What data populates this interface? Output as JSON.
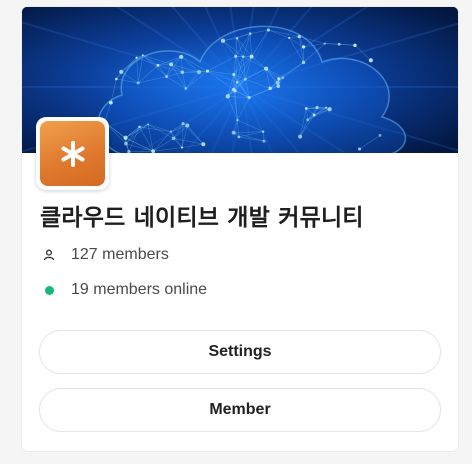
{
  "community": {
    "name": "클라우드 네이티브 개발 커뮤니티",
    "members_count": "127 members",
    "online_count": "19 members online",
    "avatar_icon": "asterisk-icon",
    "avatar_color": "#e07a2e",
    "online_color": "#17b87a"
  },
  "banner": {
    "image": "cloud-network-illustration"
  },
  "actions": {
    "settings_label": "Settings",
    "member_label": "Member"
  }
}
